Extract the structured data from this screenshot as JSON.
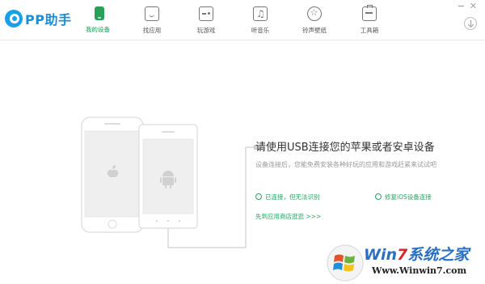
{
  "app": {
    "logo_text": "PP助手"
  },
  "nav": {
    "items": [
      {
        "label": "我的设备",
        "icon": "device-icon",
        "active": true
      },
      {
        "label": "找应用",
        "icon": "app-store-icon",
        "active": false
      },
      {
        "label": "玩游戏",
        "icon": "gamepad-icon",
        "active": false
      },
      {
        "label": "听音乐",
        "icon": "music-icon",
        "active": false
      },
      {
        "label": "铃声壁纸",
        "icon": "ringtone-wallpaper-icon",
        "active": false
      },
      {
        "label": "工具箱",
        "icon": "toolbox-icon",
        "active": false
      }
    ]
  },
  "window_controls": [
    "minimize-icon",
    "close-icon"
  ],
  "main": {
    "headline": "请使用USB连接您的苹果或者安卓设备",
    "subtext": "设备连接后，您能免费安装各种好玩的应用和游戏赶紧来试试吧",
    "link_connected": "已连接，但无法识别",
    "link_repair": "修复iOS设备连接",
    "link_store": "先到应用商店逛逛 >>>"
  },
  "watermark": {
    "title_prefix": "Win",
    "title_accent": "7",
    "title_suffix": "系统之家",
    "url": "Www.Winwin7.com"
  },
  "colors": {
    "accent_green": "#27a05a",
    "logo_blue": "#1a8fd8",
    "text_gray": "#999999"
  }
}
